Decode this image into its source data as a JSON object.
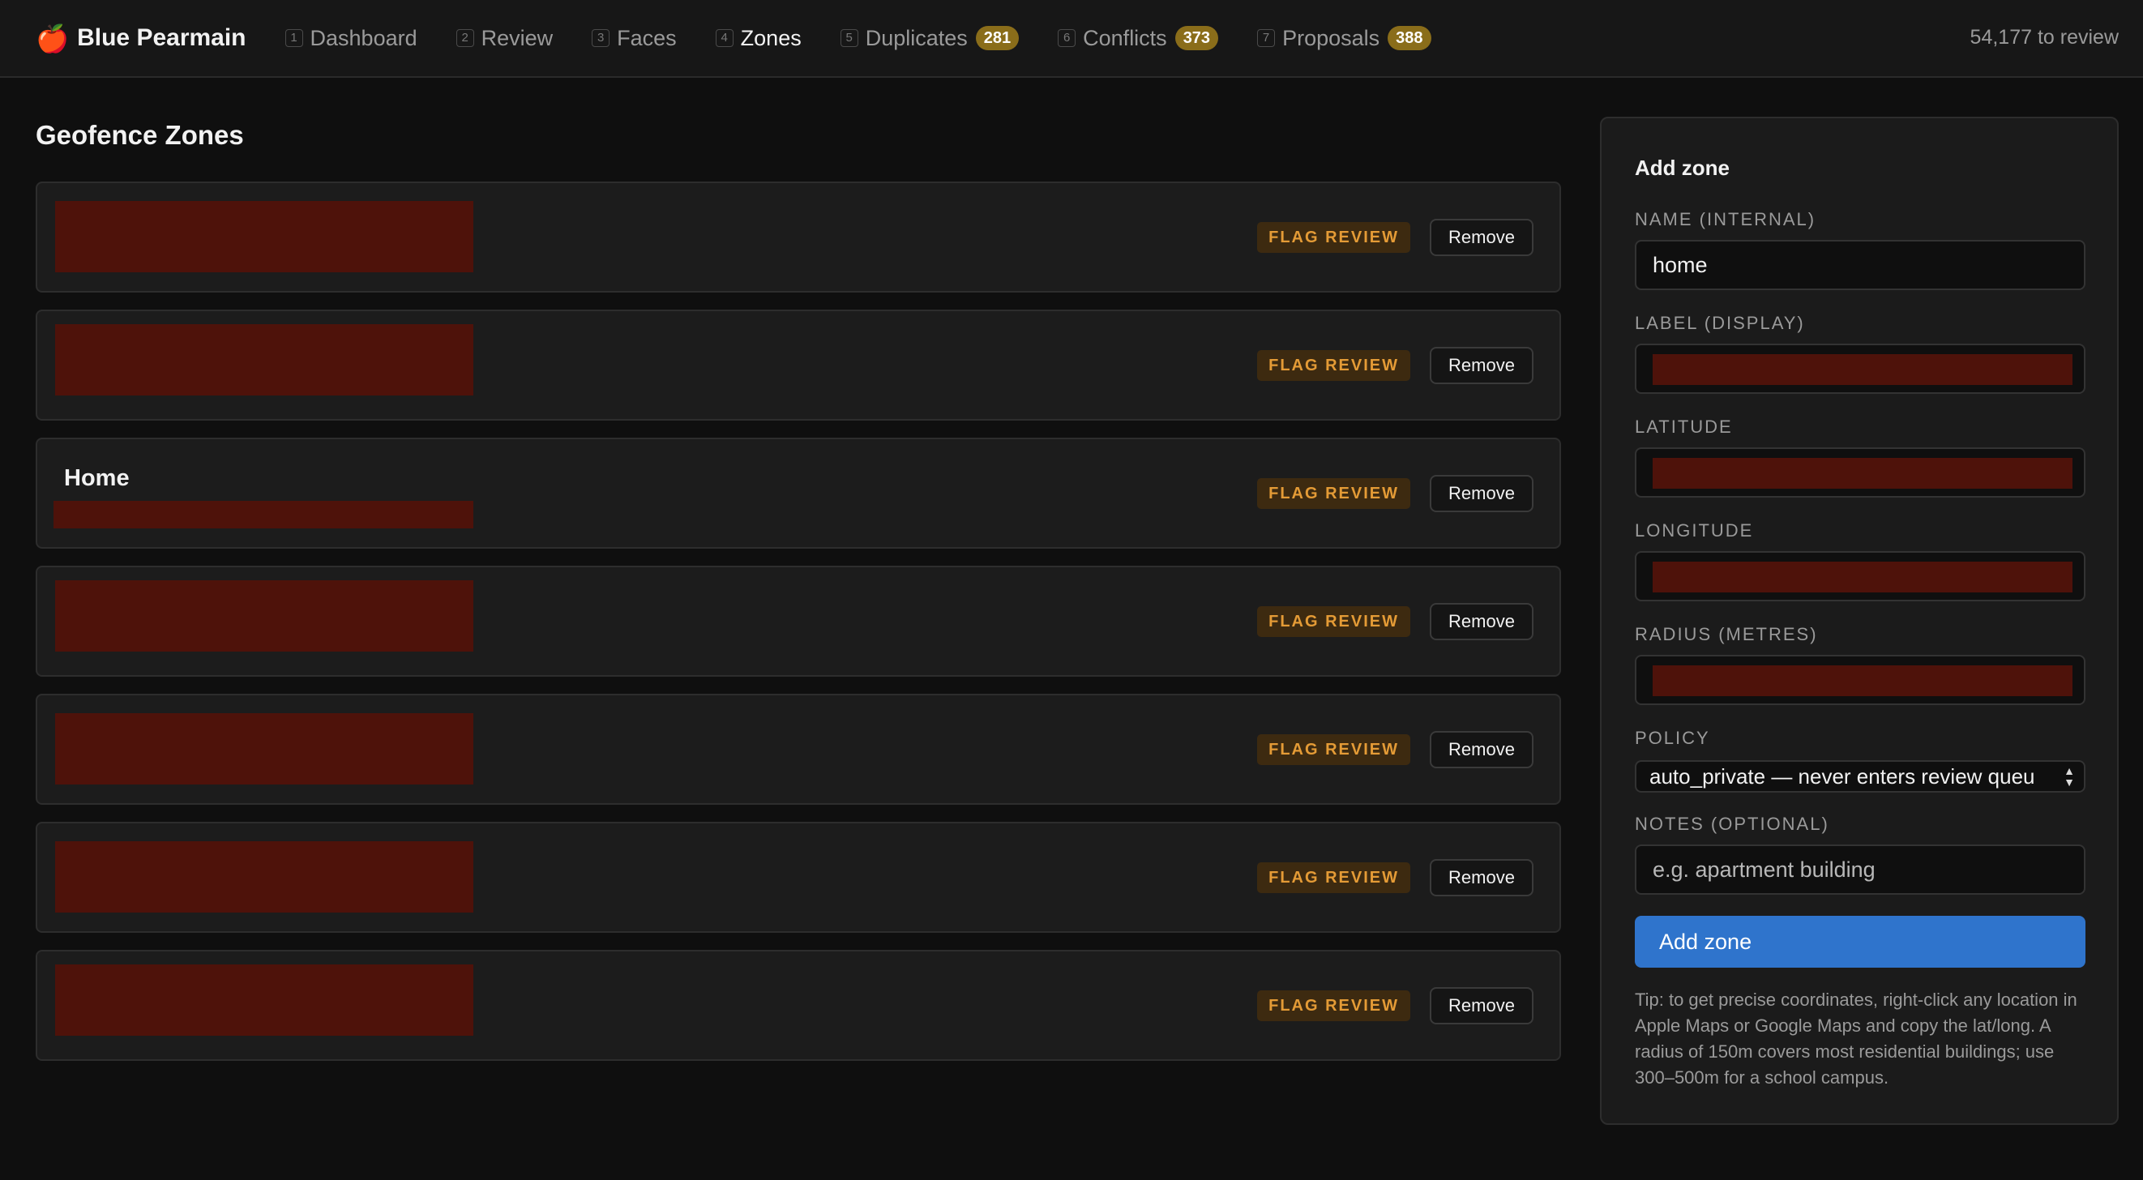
{
  "app": {
    "brand_icon": "🍎",
    "brand_name": "Blue Pearmain",
    "review_count": "54,177 to review"
  },
  "nav": {
    "items": [
      {
        "num": "1",
        "label": "Dashboard",
        "active": false
      },
      {
        "num": "2",
        "label": "Review",
        "active": false
      },
      {
        "num": "3",
        "label": "Faces",
        "active": false
      },
      {
        "num": "4",
        "label": "Zones",
        "active": true
      },
      {
        "num": "5",
        "label": "Duplicates",
        "badge": "281",
        "active": false
      },
      {
        "num": "6",
        "label": "Conflicts",
        "badge": "373",
        "active": false
      },
      {
        "num": "7",
        "label": "Proposals",
        "badge": "388",
        "active": false
      }
    ]
  },
  "main": {
    "title": "Geofence Zones",
    "zones": [
      {
        "label": "",
        "redacted": true,
        "policy_badge": "FLAG REVIEW",
        "remove_label": "Remove"
      },
      {
        "label": "",
        "redacted": true,
        "policy_badge": "FLAG REVIEW",
        "remove_label": "Remove"
      },
      {
        "label": "Home",
        "redacted": true,
        "policy_badge": "FLAG REVIEW",
        "remove_label": "Remove"
      },
      {
        "label": "",
        "redacted": true,
        "policy_badge": "FLAG REVIEW",
        "remove_label": "Remove"
      },
      {
        "label": "",
        "redacted": true,
        "policy_badge": "FLAG REVIEW",
        "remove_label": "Remove"
      },
      {
        "label": "",
        "redacted": true,
        "policy_badge": "FLAG REVIEW",
        "remove_label": "Remove"
      },
      {
        "label": "",
        "redacted": true,
        "policy_badge": "FLAG REVIEW",
        "remove_label": "Remove"
      }
    ]
  },
  "form": {
    "title": "Add zone",
    "name_label": "NAME (INTERNAL)",
    "name_value": "home",
    "display_label": "LABEL (DISPLAY)",
    "latitude_label": "LATITUDE",
    "longitude_label": "LONGITUDE",
    "radius_label": "RADIUS (METRES)",
    "policy_label": "POLICY",
    "policy_value": "auto_private — never enters review queu",
    "notes_label": "NOTES (OPTIONAL)",
    "notes_placeholder": "e.g. apartment building",
    "submit_label": "Add zone",
    "tip": "Tip: to get precise coordinates, right-click any location in Apple Maps or Google Maps and copy the lat/long. A radius of 150m covers most residential buildings; use 300–500m for a school campus."
  },
  "colors": {
    "accent": "#2f74cc",
    "badge": "#8a6d1a",
    "flag_text": "#e49b36",
    "redaction": "#4e120a"
  }
}
